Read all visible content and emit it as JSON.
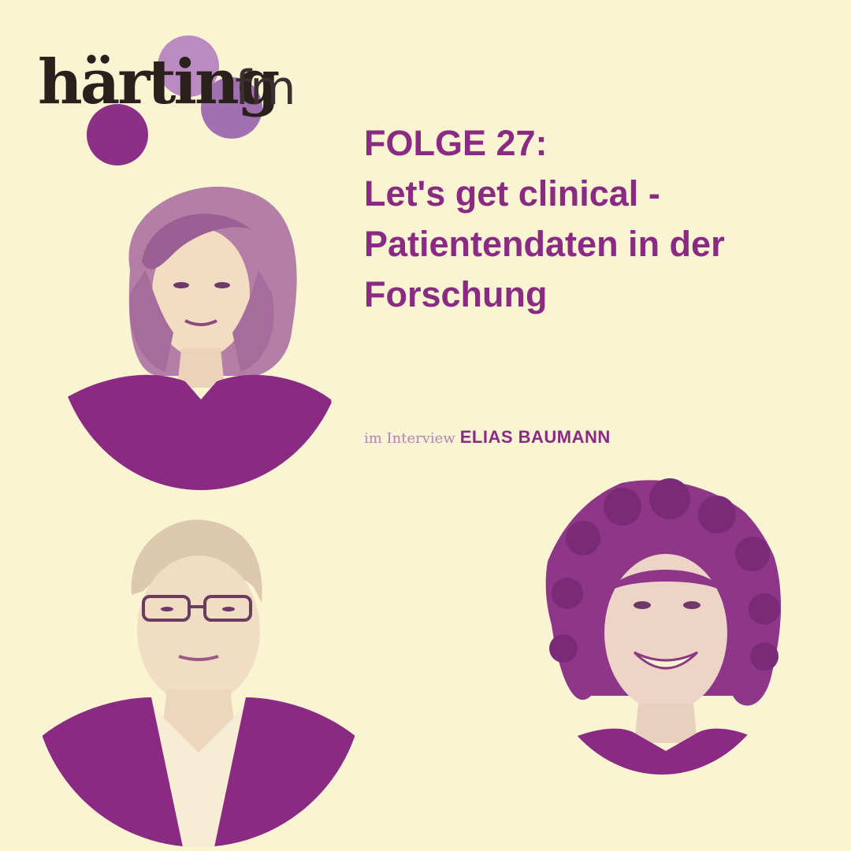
{
  "logo": {
    "wordmark": "härting",
    "suffix": "fm"
  },
  "episode": {
    "line1": "FOLGE 27:",
    "line2": "Let's get clinical -",
    "line3": "Patientendaten in der",
    "line4": "Forschung"
  },
  "interview": {
    "prefix": "im Interview",
    "guest": "ELIAS BAUMANN"
  },
  "colors": {
    "background": "#fbf4d3",
    "accent": "#8a2a83",
    "light_accent": "#b184b9",
    "logo_text": "#2a201c"
  }
}
